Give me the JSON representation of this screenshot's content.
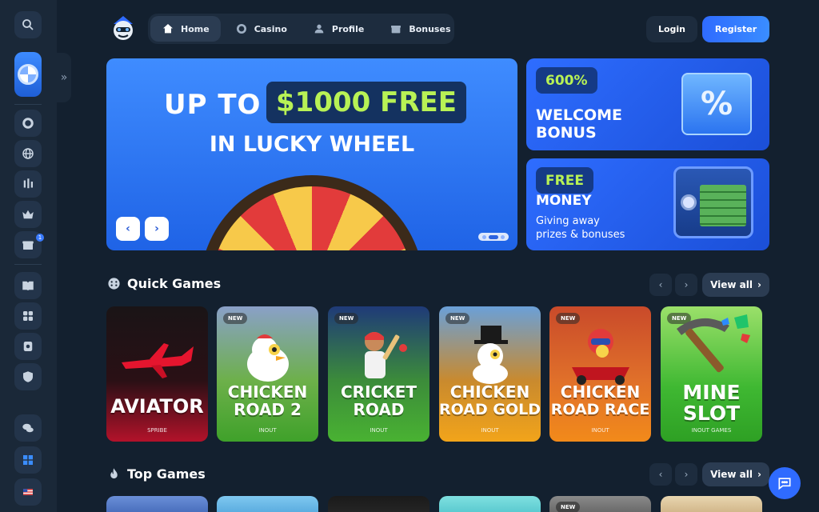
{
  "nav": {
    "items": [
      {
        "label": "Home",
        "icon": "home-icon",
        "active": true
      },
      {
        "label": "Casino",
        "icon": "chip-icon",
        "active": false
      },
      {
        "label": "Profile",
        "icon": "user-icon",
        "active": false
      },
      {
        "label": "Bonuses",
        "icon": "gift-icon",
        "active": false
      }
    ],
    "login": "Login",
    "register": "Register"
  },
  "hero": {
    "line1_prefix": "UP TO",
    "line1_highlight": "$1000 FREE",
    "line2": "IN LUCKY WHEEL",
    "prev": "‹",
    "next": "›"
  },
  "promos": [
    {
      "tag": "600%",
      "title_l1": "WELCOME",
      "title_l2": "BONUS"
    },
    {
      "tag": "FREE",
      "title": "MONEY",
      "sub_l1": "Giving away",
      "sub_l2": "prizes & bonuses",
      "glyph": "%"
    }
  ],
  "quick_games": {
    "title": "Quick Games",
    "view_all": "View all",
    "items": [
      {
        "name_l1": "AVIATOR",
        "name_l2": "",
        "provider": "SPRIBE",
        "badge": ""
      },
      {
        "name_l1": "CHICKEN",
        "name_l2": "ROAD 2",
        "provider": "INOUT",
        "badge": "NEW"
      },
      {
        "name_l1": "CRICKET",
        "name_l2": "ROAD",
        "provider": "INOUT",
        "badge": "NEW"
      },
      {
        "name_l1": "CHICKEN",
        "name_l2": "ROAD GOLD",
        "provider": "INOUT",
        "badge": "NEW"
      },
      {
        "name_l1": "CHICKEN",
        "name_l2": "ROAD RACE",
        "provider": "INOUT",
        "badge": "NEW"
      },
      {
        "name_l1": "MINE",
        "name_l2": "SLOT",
        "provider": "INOUT GAMES",
        "badge": "NEW"
      }
    ]
  },
  "top_games": {
    "title": "Top Games",
    "view_all": "View all",
    "badge": "NEW"
  },
  "sidebar": {
    "notification_count": "1",
    "expand": "»"
  },
  "colors": {
    "accent": "#2f6bff",
    "lime": "#b8f255",
    "bg": "#13202f"
  }
}
